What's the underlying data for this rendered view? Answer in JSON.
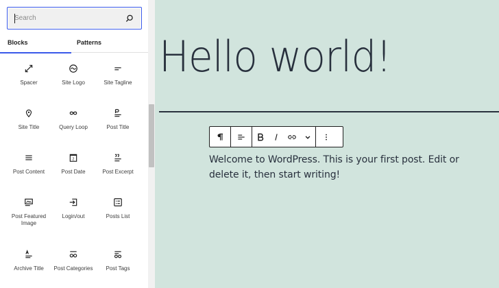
{
  "sidebar": {
    "search": {
      "placeholder": "Search",
      "value": ""
    },
    "tabs": [
      {
        "label": "Blocks",
        "active": true
      },
      {
        "label": "Patterns",
        "active": false
      }
    ],
    "blocks": [
      {
        "label": "Spacer",
        "icon": "spacer-icon"
      },
      {
        "label": "Site Logo",
        "icon": "site-logo-icon"
      },
      {
        "label": "Site Tagline",
        "icon": "site-tagline-icon"
      },
      {
        "label": "Site Title",
        "icon": "site-title-icon"
      },
      {
        "label": "Query Loop",
        "icon": "query-loop-icon"
      },
      {
        "label": "Post Title",
        "icon": "post-title-icon"
      },
      {
        "label": "Post Content",
        "icon": "post-content-icon"
      },
      {
        "label": "Post Date",
        "icon": "post-date-icon"
      },
      {
        "label": "Post Excerpt",
        "icon": "post-excerpt-icon"
      },
      {
        "label": "Post Featured Image",
        "icon": "post-featured-image-icon"
      },
      {
        "label": "Login/out",
        "icon": "login-out-icon"
      },
      {
        "label": "Posts List",
        "icon": "posts-list-icon"
      },
      {
        "label": "Archive Title",
        "icon": "archive-title-icon"
      },
      {
        "label": "Post Categories",
        "icon": "post-categories-icon"
      },
      {
        "label": "Post Tags",
        "icon": "post-tags-icon"
      }
    ]
  },
  "editor": {
    "post_title": "Hello world!",
    "paragraph": "Welcome to WordPress. This is your first post. Edit or delete it, then start writing!",
    "toolbar": [
      "paragraph-icon",
      "align-icon",
      "bold-icon",
      "italic-icon",
      "link-icon",
      "chevron-down-icon",
      "more-options-icon"
    ]
  },
  "colors": {
    "accent": "#3858e9",
    "canvas_background": "#d1e4dd",
    "text": "#28303d"
  }
}
